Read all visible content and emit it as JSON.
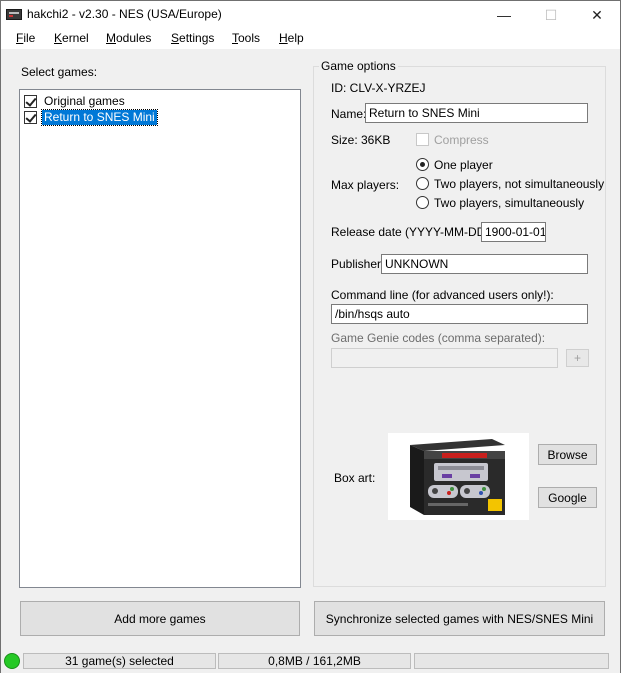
{
  "window": {
    "title": "hakchi2 - v2.30 - NES (USA/Europe)",
    "minimize": "—",
    "maximize": "☐",
    "close": "✕"
  },
  "menu": [
    "File",
    "Kernel",
    "Modules",
    "Settings",
    "Tools",
    "Help"
  ],
  "games_panel": {
    "label": "Select games:",
    "items": [
      {
        "label": "Original games",
        "checked": true
      },
      {
        "label": "Return to SNES Mini",
        "checked": true,
        "selected": true
      }
    ]
  },
  "game_options": {
    "title": "Game options",
    "id_text": "ID: CLV-X-YRZEJ",
    "name_label": "Name:",
    "name_value": "Return to SNES Mini",
    "size_text": "Size: 36KB",
    "compress_label": "Compress",
    "max_players_label": "Max players:",
    "players_options": [
      {
        "label": "One player",
        "checked": true
      },
      {
        "label": "Two players, not simultaneously",
        "checked": false
      },
      {
        "label": "Two players, simultaneously",
        "checked": false
      }
    ],
    "release_label": "Release date (YYYY-MM-DD):",
    "release_value": "1900-01-01",
    "publisher_label": "Publisher:",
    "publisher_value": "UNKNOWN",
    "cmdline_label": "Command line (for advanced users only!):",
    "cmdline_value": "/bin/hsqs auto",
    "genie_label": "Game Genie codes (comma separated):",
    "genie_value": "",
    "genie_add": "+",
    "boxart_label": "Box art:",
    "browse_label": "Browse",
    "google_label": "Google"
  },
  "buttons": {
    "add_games": "Add more games",
    "sync": "Synchronize selected games with NES/SNES Mini"
  },
  "status": {
    "selected": "31 game(s) selected",
    "size": "0,8MB / 161,2MB",
    "indicator_color": "#26c926"
  }
}
